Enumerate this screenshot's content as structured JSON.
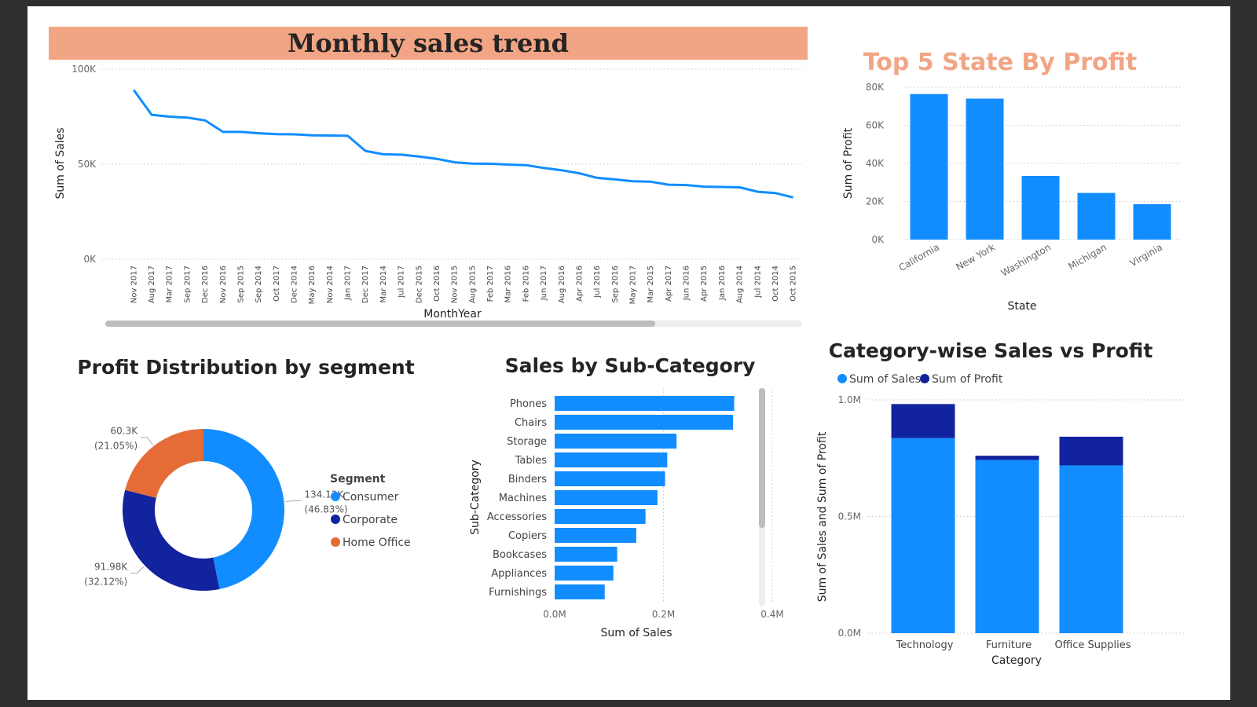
{
  "dashboard": {
    "line_chart": {
      "title": "Monthly sales trend",
      "title_bg": "#f2a585",
      "x_label": "MonthYear",
      "y_label": "Sum of Sales"
    },
    "state_chart": {
      "title": "Top 5 State By Profit",
      "title_color": "#f2a585",
      "x_label": "State",
      "y_label": "Sum of Profit"
    },
    "segment_chart": {
      "title": "Profit Distribution by segment",
      "legend_title": "Segment"
    },
    "subcat_chart": {
      "title": "Sales by Sub-Category",
      "x_label": "Sum of Sales",
      "y_label": "Sub-Category"
    },
    "category_chart": {
      "title": "Category-wise Sales vs Profit",
      "x_label": "Category",
      "y_label": "Sum of Sales and Sum of Profit",
      "legend": [
        "Sum of Sales",
        "Sum of Profit"
      ]
    }
  },
  "colors": {
    "blue": "#118dff",
    "navy": "#12239e",
    "orange": "#e66c37",
    "accent": "#f2a585"
  },
  "chart_data": [
    {
      "id": "monthly",
      "type": "line",
      "title": "Monthly sales trend",
      "xlabel": "MonthYear",
      "ylabel": "Sum of Sales",
      "ylim": [
        0,
        100000
      ],
      "yticks": [
        "0K",
        "50K",
        "100K"
      ],
      "x": [
        "Nov 2017",
        "Aug 2017",
        "Mar 2017",
        "Sep 2017",
        "Dec 2016",
        "Nov 2016",
        "Sep 2015",
        "Sep 2014",
        "Oct 2017",
        "Dec 2014",
        "May 2016",
        "Nov 2014",
        "Jan 2017",
        "Dec 2017",
        "Mar 2014",
        "Jul 2017",
        "Dec 2015",
        "Oct 2016",
        "Nov 2015",
        "Aug 2015",
        "Feb 2017",
        "Mar 2016",
        "Feb 2016",
        "Jun 2017",
        "Aug 2016",
        "Apr 2016",
        "Jul 2016",
        "Sep 2016",
        "May 2017",
        "Mar 2015",
        "Apr 2017",
        "Jun 2016",
        "Apr 2015",
        "Jan 2016",
        "Aug 2014",
        "Jul 2014",
        "Oct 2014",
        "Oct 2015"
      ],
      "values": [
        89000,
        76000,
        75000,
        74500,
        73000,
        67000,
        67000,
        66300,
        65800,
        65700,
        65200,
        65100,
        64900,
        57000,
        55200,
        55000,
        54000,
        52800,
        51000,
        50300,
        50200,
        49800,
        49500,
        48000,
        46800,
        45200,
        42800,
        42000,
        41000,
        40800,
        39200,
        39000,
        38200,
        38000,
        37800,
        35500,
        34800,
        32500
      ],
      "grid": true
    },
    {
      "id": "states",
      "type": "bar",
      "title": "Top 5 State By Profit",
      "xlabel": "State",
      "ylabel": "Sum of Profit",
      "categories": [
        "California",
        "New York",
        "Washington",
        "Michigan",
        "Virginia"
      ],
      "values": [
        76400,
        74000,
        33400,
        24500,
        18600
      ],
      "ylim": [
        0,
        80000
      ],
      "yticks": [
        "0K",
        "20K",
        "40K",
        "60K",
        "80K"
      ],
      "grid": true
    },
    {
      "id": "segments",
      "type": "pie",
      "title": "Profit Distribution by segment",
      "legend_title": "Segment",
      "labels": [
        "Consumer",
        "Corporate",
        "Home Office"
      ],
      "values": [
        134120,
        91980,
        60300
      ],
      "value_labels": [
        "134.12K",
        "91.98K",
        "60.3K"
      ],
      "percent_labels": [
        "(46.83%)",
        "(32.12%)",
        "(21.05%)"
      ]
    },
    {
      "id": "subcategory",
      "type": "bar",
      "orientation": "horizontal",
      "title": "Sales by Sub-Category",
      "xlabel": "Sum of Sales",
      "ylabel": "Sub-Category",
      "categories": [
        "Phones",
        "Chairs",
        "Storage",
        "Tables",
        "Binders",
        "Machines",
        "Accessories",
        "Copiers",
        "Bookcases",
        "Appliances",
        "Furnishings"
      ],
      "values": [
        330000,
        328000,
        224000,
        207000,
        203000,
        189000,
        167000,
        150000,
        115000,
        108000,
        92000
      ],
      "xlim": [
        0,
        400000
      ],
      "xticks": [
        "0.0M",
        "0.2M",
        "0.4M"
      ]
    },
    {
      "id": "category",
      "type": "bar",
      "stacked": true,
      "title": "Category-wise Sales vs Profit",
      "xlabel": "Category",
      "ylabel": "Sum of Sales and Sum of Profit",
      "categories": [
        "Technology",
        "Furniture",
        "Office Supplies"
      ],
      "series": [
        {
          "name": "Sum of Sales",
          "values": [
            836000,
            742000,
            719000
          ]
        },
        {
          "name": "Sum of Profit",
          "values": [
            146000,
            18500,
            123000
          ]
        }
      ],
      "ylim": [
        0,
        1000000
      ],
      "yticks": [
        "0.0M",
        "0.5M",
        "1.0M"
      ],
      "legend": "top-left",
      "grid": true
    }
  ]
}
